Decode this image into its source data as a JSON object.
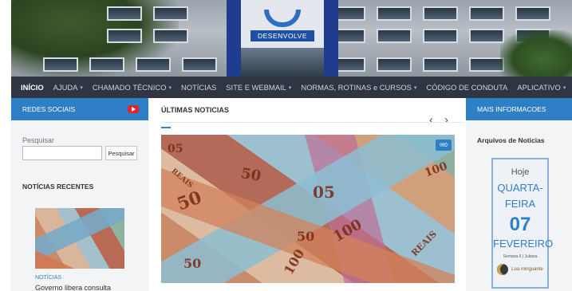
{
  "header": {
    "logo_text": "DESENVOLVE"
  },
  "nav": {
    "items": [
      {
        "label": "INÍCIO",
        "active": true,
        "dropdown": false
      },
      {
        "label": "AJUDA",
        "active": false,
        "dropdown": true
      },
      {
        "label": "CHAMADO TÉCNICO",
        "active": false,
        "dropdown": true
      },
      {
        "label": "NOTÍCIAS",
        "active": false,
        "dropdown": false
      },
      {
        "label": "SITE E WEBMAIL",
        "active": false,
        "dropdown": true
      },
      {
        "label": "NORMAS, ROTINAS e CURSOS",
        "active": false,
        "dropdown": true
      },
      {
        "label": "CÓDIGO DE CONDUTA",
        "active": false,
        "dropdown": false
      },
      {
        "label": "APLICATIVO",
        "active": false,
        "dropdown": true
      }
    ]
  },
  "left": {
    "social_title": "REDES SOCIAIS",
    "social_icon": "youtube-icon",
    "search_label": "Pesquisar",
    "search_value": "",
    "search_button": "Pesquisar",
    "recent_title": "NOTÍCIAS RECENTES",
    "recent_category": "NOTÍCIAS",
    "recent_headline": "Governo libera consulta"
  },
  "center": {
    "title": "ÚLTIMAS NOTICIAS",
    "prev_glyph": "‹",
    "next_glyph": "›",
    "comments": "0",
    "note_labels": [
      "50",
      "05",
      "50",
      "100",
      "50",
      "REAIS",
      "100",
      "05",
      "50",
      "100",
      "REAIS"
    ]
  },
  "right": {
    "title": "MAIS INFORMACOES",
    "archive_title": "Arquivos de Noticias",
    "cal_today": "Hoje",
    "cal_weekday_1": "QUARTA-",
    "cal_weekday_2": "FEIRA",
    "cal_day": "07",
    "cal_month": "FEVEREIRO",
    "cal_week": "Semana 6 | Juliana",
    "moon_phase": "Lua minguante"
  },
  "colors": {
    "accent": "#2f7fc6",
    "nav_bg": "#2f3542",
    "youtube": "#e0262a"
  }
}
